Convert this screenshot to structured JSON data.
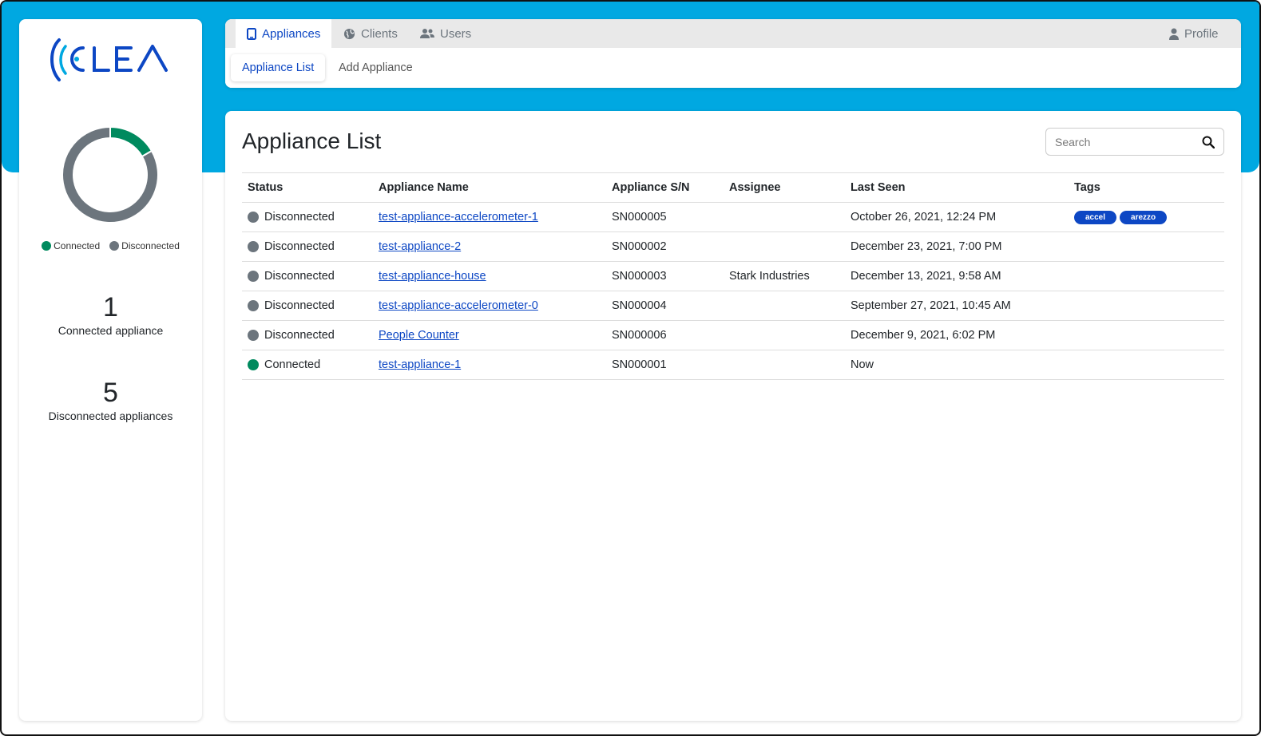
{
  "brand": {
    "name": "CLEA",
    "accent": "#0d47c4",
    "band_color": "#00a8e1"
  },
  "sidebar": {
    "chart_data": {
      "type": "pie",
      "categories": [
        "Connected",
        "Disconnected"
      ],
      "values": [
        1,
        5
      ],
      "colors": [
        "#008a5e",
        "#6c757d"
      ],
      "legend": "bottom"
    },
    "legend": {
      "connected": "Connected",
      "disconnected": "Disconnected"
    },
    "connected_count": "1",
    "connected_label": "Connected appliance",
    "disconnected_count": "5",
    "disconnected_label": "Disconnected appliances"
  },
  "nav": {
    "tabs": [
      {
        "label": "Appliances",
        "icon": "tablet-icon"
      },
      {
        "label": "Clients",
        "icon": "globe-icon"
      },
      {
        "label": "Users",
        "icon": "users-icon"
      }
    ],
    "profile": "Profile",
    "subtabs": [
      "Appliance List",
      "Add Appliance"
    ]
  },
  "main": {
    "title": "Appliance List",
    "search_placeholder": "Search",
    "columns": [
      "Status",
      "Appliance Name",
      "Appliance S/N",
      "Assignee",
      "Last Seen",
      "Tags"
    ],
    "rows": [
      {
        "status": "Disconnected",
        "name": "test-appliance-accelerometer-1",
        "sn": "SN000005",
        "assignee": "",
        "last_seen": "October 26, 2021, 12:24 PM",
        "tags": [
          "accel",
          "arezzo"
        ]
      },
      {
        "status": "Disconnected",
        "name": "test-appliance-2",
        "sn": "SN000002",
        "assignee": "",
        "last_seen": "December 23, 2021, 7:00 PM",
        "tags": []
      },
      {
        "status": "Disconnected",
        "name": "test-appliance-house",
        "sn": "SN000003",
        "assignee": "Stark Industries",
        "last_seen": "December 13, 2021, 9:58 AM",
        "tags": []
      },
      {
        "status": "Disconnected",
        "name": "test-appliance-accelerometer-0",
        "sn": "SN000004",
        "assignee": "",
        "last_seen": "September 27, 2021, 10:45 AM",
        "tags": []
      },
      {
        "status": "Disconnected",
        "name": "People Counter",
        "sn": "SN000006",
        "assignee": "",
        "last_seen": "December 9, 2021, 6:02 PM",
        "tags": []
      },
      {
        "status": "Connected",
        "name": "test-appliance-1",
        "sn": "SN000001",
        "assignee": "",
        "last_seen": "Now",
        "tags": []
      }
    ],
    "status_colors": {
      "Connected": "#008a5e",
      "Disconnected": "#6c757d"
    }
  }
}
